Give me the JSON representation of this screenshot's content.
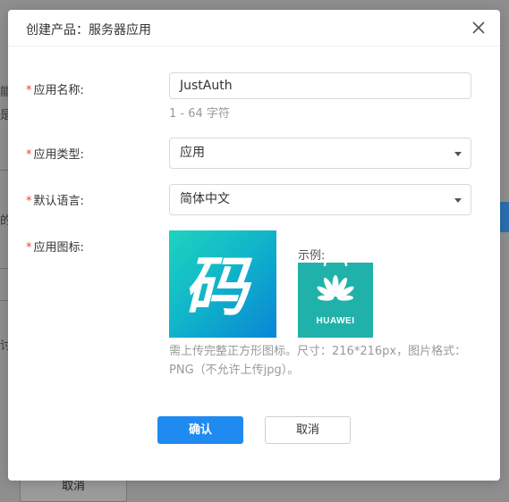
{
  "background": {
    "fragments": [
      "能",
      "是,",
      "的",
      "讨",
      "取消"
    ]
  },
  "modal": {
    "title": "创建产品：服务器应用",
    "close_icon": "close-icon"
  },
  "form": {
    "required_mark": "*",
    "app_name": {
      "label": "应用名称:",
      "value": "JustAuth",
      "hint": "1 - 64 字符"
    },
    "app_type": {
      "label": "应用类型:",
      "value": "应用"
    },
    "default_language": {
      "label": "默认语言:",
      "value": "简体中文"
    },
    "app_icon": {
      "label": "应用图标:",
      "tile_glyph": "码",
      "example_label": "示例:",
      "example_brand": "HUAWEI",
      "description": "需上传完整正方形图标。尺寸：216*216px，图片格式：PNG（不允许上传jpg）。"
    }
  },
  "buttons": {
    "confirm": "确认",
    "cancel": "取消"
  },
  "colors": {
    "primary": "#1f8bf0",
    "required": "#f04134",
    "icon_gradient_start": "#1fd3bf",
    "icon_gradient_end": "#0a85d6",
    "example_bg": "#20b2aa"
  }
}
